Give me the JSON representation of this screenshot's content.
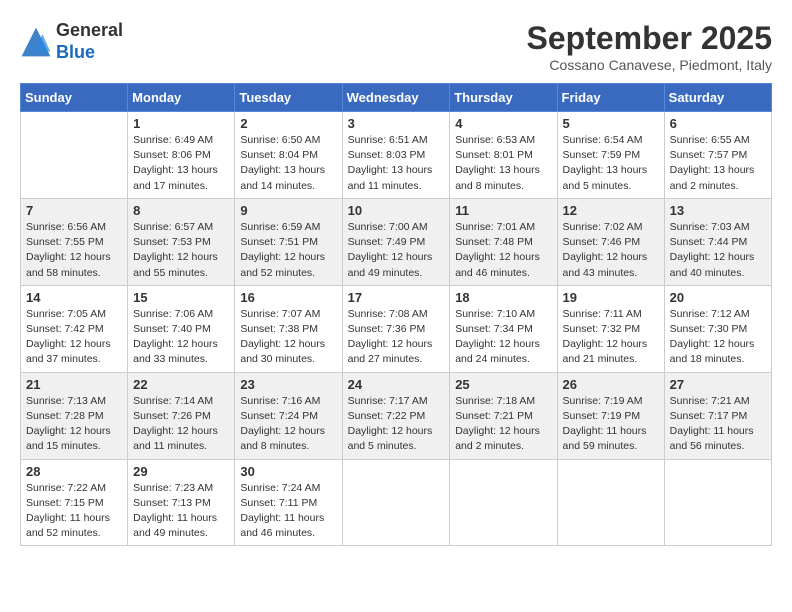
{
  "header": {
    "logo_line1": "General",
    "logo_line2": "Blue",
    "month_title": "September 2025",
    "location": "Cossano Canavese, Piedmont, Italy"
  },
  "weekdays": [
    "Sunday",
    "Monday",
    "Tuesday",
    "Wednesday",
    "Thursday",
    "Friday",
    "Saturday"
  ],
  "weeks": [
    [
      {
        "day": "",
        "sunrise": "",
        "sunset": "",
        "daylight": ""
      },
      {
        "day": "1",
        "sunrise": "Sunrise: 6:49 AM",
        "sunset": "Sunset: 8:06 PM",
        "daylight": "Daylight: 13 hours and 17 minutes."
      },
      {
        "day": "2",
        "sunrise": "Sunrise: 6:50 AM",
        "sunset": "Sunset: 8:04 PM",
        "daylight": "Daylight: 13 hours and 14 minutes."
      },
      {
        "day": "3",
        "sunrise": "Sunrise: 6:51 AM",
        "sunset": "Sunset: 8:03 PM",
        "daylight": "Daylight: 13 hours and 11 minutes."
      },
      {
        "day": "4",
        "sunrise": "Sunrise: 6:53 AM",
        "sunset": "Sunset: 8:01 PM",
        "daylight": "Daylight: 13 hours and 8 minutes."
      },
      {
        "day": "5",
        "sunrise": "Sunrise: 6:54 AM",
        "sunset": "Sunset: 7:59 PM",
        "daylight": "Daylight: 13 hours and 5 minutes."
      },
      {
        "day": "6",
        "sunrise": "Sunrise: 6:55 AM",
        "sunset": "Sunset: 7:57 PM",
        "daylight": "Daylight: 13 hours and 2 minutes."
      }
    ],
    [
      {
        "day": "7",
        "sunrise": "Sunrise: 6:56 AM",
        "sunset": "Sunset: 7:55 PM",
        "daylight": "Daylight: 12 hours and 58 minutes."
      },
      {
        "day": "8",
        "sunrise": "Sunrise: 6:57 AM",
        "sunset": "Sunset: 7:53 PM",
        "daylight": "Daylight: 12 hours and 55 minutes."
      },
      {
        "day": "9",
        "sunrise": "Sunrise: 6:59 AM",
        "sunset": "Sunset: 7:51 PM",
        "daylight": "Daylight: 12 hours and 52 minutes."
      },
      {
        "day": "10",
        "sunrise": "Sunrise: 7:00 AM",
        "sunset": "Sunset: 7:49 PM",
        "daylight": "Daylight: 12 hours and 49 minutes."
      },
      {
        "day": "11",
        "sunrise": "Sunrise: 7:01 AM",
        "sunset": "Sunset: 7:48 PM",
        "daylight": "Daylight: 12 hours and 46 minutes."
      },
      {
        "day": "12",
        "sunrise": "Sunrise: 7:02 AM",
        "sunset": "Sunset: 7:46 PM",
        "daylight": "Daylight: 12 hours and 43 minutes."
      },
      {
        "day": "13",
        "sunrise": "Sunrise: 7:03 AM",
        "sunset": "Sunset: 7:44 PM",
        "daylight": "Daylight: 12 hours and 40 minutes."
      }
    ],
    [
      {
        "day": "14",
        "sunrise": "Sunrise: 7:05 AM",
        "sunset": "Sunset: 7:42 PM",
        "daylight": "Daylight: 12 hours and 37 minutes."
      },
      {
        "day": "15",
        "sunrise": "Sunrise: 7:06 AM",
        "sunset": "Sunset: 7:40 PM",
        "daylight": "Daylight: 12 hours and 33 minutes."
      },
      {
        "day": "16",
        "sunrise": "Sunrise: 7:07 AM",
        "sunset": "Sunset: 7:38 PM",
        "daylight": "Daylight: 12 hours and 30 minutes."
      },
      {
        "day": "17",
        "sunrise": "Sunrise: 7:08 AM",
        "sunset": "Sunset: 7:36 PM",
        "daylight": "Daylight: 12 hours and 27 minutes."
      },
      {
        "day": "18",
        "sunrise": "Sunrise: 7:10 AM",
        "sunset": "Sunset: 7:34 PM",
        "daylight": "Daylight: 12 hours and 24 minutes."
      },
      {
        "day": "19",
        "sunrise": "Sunrise: 7:11 AM",
        "sunset": "Sunset: 7:32 PM",
        "daylight": "Daylight: 12 hours and 21 minutes."
      },
      {
        "day": "20",
        "sunrise": "Sunrise: 7:12 AM",
        "sunset": "Sunset: 7:30 PM",
        "daylight": "Daylight: 12 hours and 18 minutes."
      }
    ],
    [
      {
        "day": "21",
        "sunrise": "Sunrise: 7:13 AM",
        "sunset": "Sunset: 7:28 PM",
        "daylight": "Daylight: 12 hours and 15 minutes."
      },
      {
        "day": "22",
        "sunrise": "Sunrise: 7:14 AM",
        "sunset": "Sunset: 7:26 PM",
        "daylight": "Daylight: 12 hours and 11 minutes."
      },
      {
        "day": "23",
        "sunrise": "Sunrise: 7:16 AM",
        "sunset": "Sunset: 7:24 PM",
        "daylight": "Daylight: 12 hours and 8 minutes."
      },
      {
        "day": "24",
        "sunrise": "Sunrise: 7:17 AM",
        "sunset": "Sunset: 7:22 PM",
        "daylight": "Daylight: 12 hours and 5 minutes."
      },
      {
        "day": "25",
        "sunrise": "Sunrise: 7:18 AM",
        "sunset": "Sunset: 7:21 PM",
        "daylight": "Daylight: 12 hours and 2 minutes."
      },
      {
        "day": "26",
        "sunrise": "Sunrise: 7:19 AM",
        "sunset": "Sunset: 7:19 PM",
        "daylight": "Daylight: 11 hours and 59 minutes."
      },
      {
        "day": "27",
        "sunrise": "Sunrise: 7:21 AM",
        "sunset": "Sunset: 7:17 PM",
        "daylight": "Daylight: 11 hours and 56 minutes."
      }
    ],
    [
      {
        "day": "28",
        "sunrise": "Sunrise: 7:22 AM",
        "sunset": "Sunset: 7:15 PM",
        "daylight": "Daylight: 11 hours and 52 minutes."
      },
      {
        "day": "29",
        "sunrise": "Sunrise: 7:23 AM",
        "sunset": "Sunset: 7:13 PM",
        "daylight": "Daylight: 11 hours and 49 minutes."
      },
      {
        "day": "30",
        "sunrise": "Sunrise: 7:24 AM",
        "sunset": "Sunset: 7:11 PM",
        "daylight": "Daylight: 11 hours and 46 minutes."
      },
      {
        "day": "",
        "sunrise": "",
        "sunset": "",
        "daylight": ""
      },
      {
        "day": "",
        "sunrise": "",
        "sunset": "",
        "daylight": ""
      },
      {
        "day": "",
        "sunrise": "",
        "sunset": "",
        "daylight": ""
      },
      {
        "day": "",
        "sunrise": "",
        "sunset": "",
        "daylight": ""
      }
    ]
  ]
}
